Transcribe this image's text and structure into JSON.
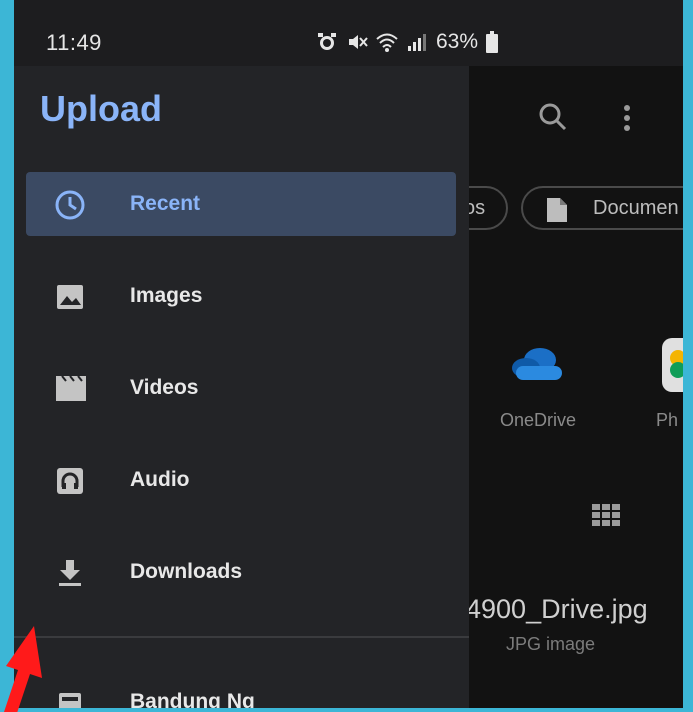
{
  "status_bar": {
    "time": "11:49",
    "battery": "63%"
  },
  "drawer": {
    "title": "Upload",
    "items": [
      {
        "label": "Recent",
        "icon": "clock-icon",
        "active": true
      },
      {
        "label": "Images",
        "icon": "image-icon",
        "active": false
      },
      {
        "label": "Videos",
        "icon": "video-icon",
        "active": false
      },
      {
        "label": "Audio",
        "icon": "audio-icon",
        "active": false
      },
      {
        "label": "Downloads",
        "icon": "download-icon",
        "active": false
      },
      {
        "label": "Bandung Ng",
        "icon": "device-icon",
        "active": false
      }
    ]
  },
  "background": {
    "chips": [
      "os",
      "Documen"
    ],
    "sources": [
      "OneDrive",
      "Ph"
    ],
    "file": {
      "name": "4900_Drive.jpg",
      "type": "JPG image"
    }
  },
  "colors": {
    "accent": "#8ab4f8",
    "drawer_bg": "#232427",
    "active_bg": "#3b4a63",
    "frame": "#3cb6d6",
    "arrow": "#ff1a1a"
  }
}
